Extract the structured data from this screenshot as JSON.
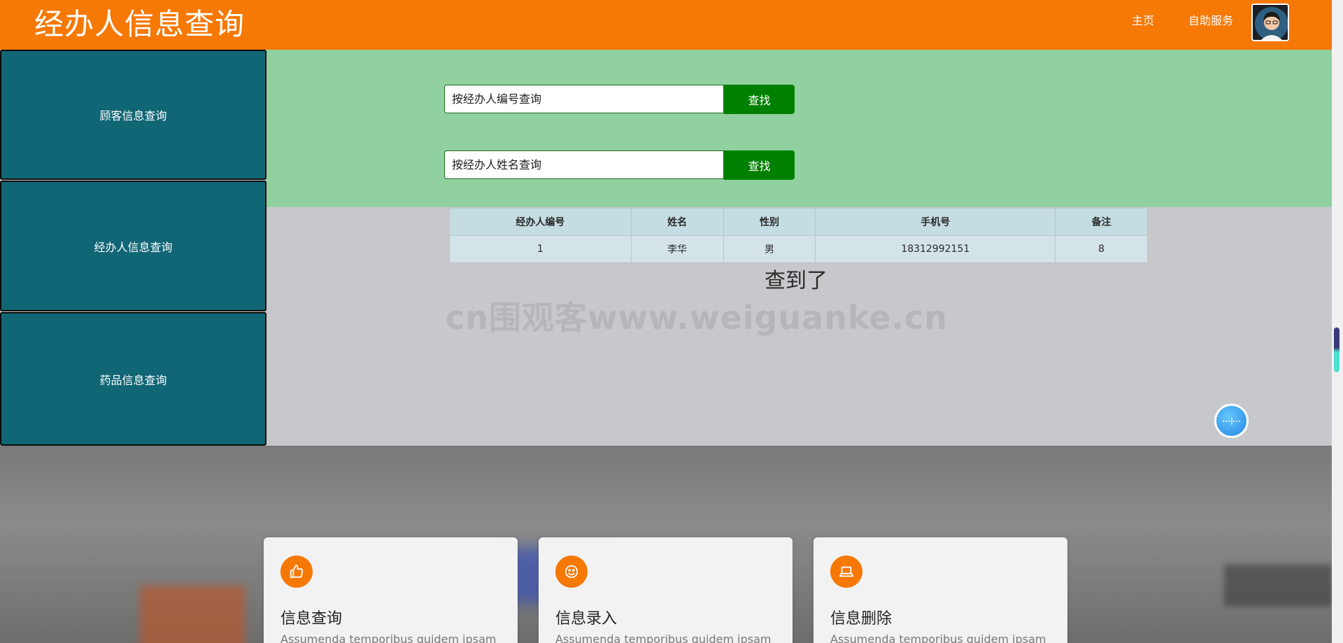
{
  "header": {
    "title": "经办人信息查询",
    "nav": [
      {
        "label": "主页"
      },
      {
        "label": "自助服务"
      }
    ]
  },
  "sidebar": {
    "items": [
      {
        "label": "顾客信息查询"
      },
      {
        "label": "经办人信息查询"
      },
      {
        "label": "药品信息查询"
      }
    ]
  },
  "search": {
    "by_id": {
      "placeholder": "按经办人编号查询",
      "button_label": "查找"
    },
    "by_name": {
      "placeholder": "按经办人姓名查询",
      "button_label": "查找"
    }
  },
  "table": {
    "headers": [
      "经办人编号",
      "姓名",
      "性别",
      "手机号",
      "备注"
    ],
    "rows": [
      [
        "1",
        "李华",
        "男",
        "18312992151",
        "8"
      ]
    ]
  },
  "status_text": "查到了",
  "watermark": "cn围观客www.weiguanke.cn",
  "cards": [
    {
      "icon": "thumbs-up-icon",
      "title": "信息查询",
      "text": "Assumenda temporibus quidem ipsam"
    },
    {
      "icon": "smiley-icon",
      "title": "信息录入",
      "text": "Assumenda temporibus quidem ipsam"
    },
    {
      "icon": "laptop-icon",
      "title": "信息删除",
      "text": "Assumenda temporibus quidem ipsam"
    }
  ],
  "colors": {
    "header": "#f67805",
    "sidebar": "#116675",
    "search_panel": "#91d19f",
    "search_button": "#008001"
  }
}
